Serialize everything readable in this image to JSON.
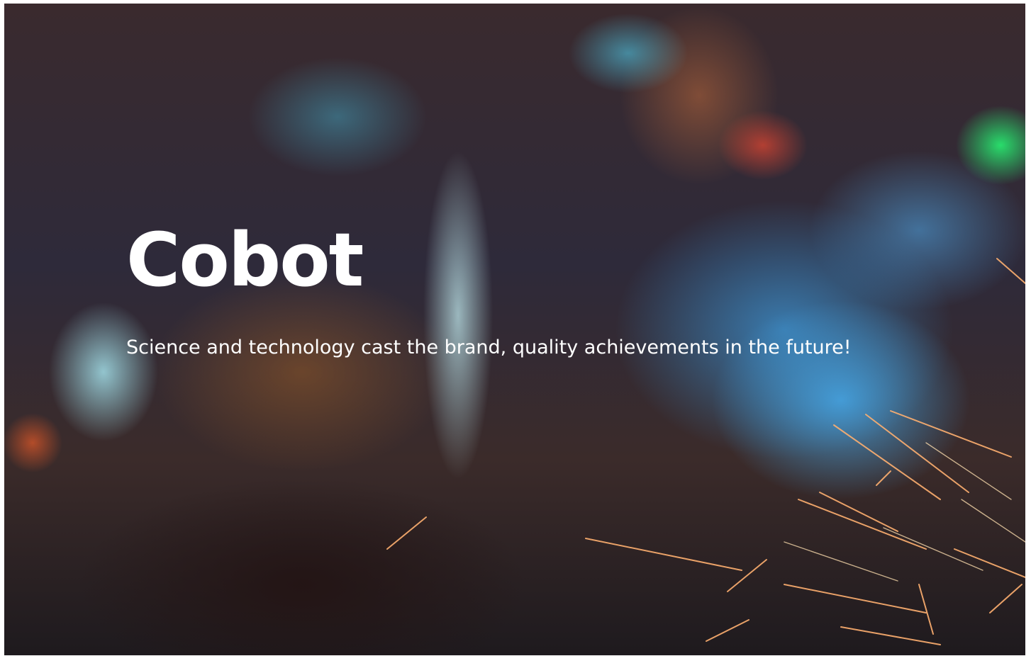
{
  "hero": {
    "title": "Cobot",
    "subtitle": "Science and technology cast the brand, quality achievements in the future!",
    "background_image": "welding-sparks-photo",
    "text_color": "#ffffff"
  }
}
